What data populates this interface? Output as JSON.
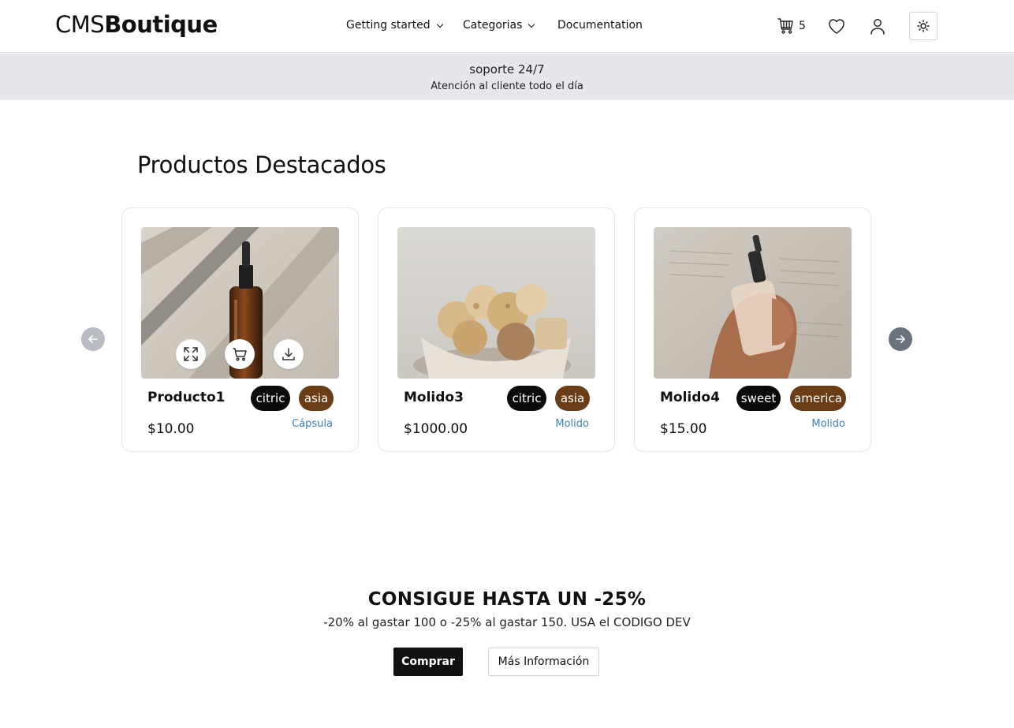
{
  "header": {
    "logo_light": "CMS",
    "logo_bold": "Boutique",
    "nav": [
      {
        "label": "Getting started",
        "has_dropdown": true
      },
      {
        "label": "Categorias",
        "has_dropdown": true
      },
      {
        "label": "Documentation",
        "has_dropdown": false
      }
    ],
    "cart_count": "5",
    "icons": [
      "cart-icon",
      "heart-icon",
      "user-icon",
      "sun-icon"
    ]
  },
  "banner": {
    "title": "soporte 24/7",
    "subtitle": "Atención al cliente todo el día"
  },
  "featured": {
    "title": "Productos Destacados",
    "products": [
      {
        "name": "Producto1",
        "price": "$10.00",
        "category": "Cápsula",
        "tags": [
          "citric",
          "asia"
        ]
      },
      {
        "name": "Molido3",
        "price": "$1000.00",
        "category": "Molido",
        "tags": [
          "citric",
          "asia"
        ]
      },
      {
        "name": "Molido4",
        "price": "$15.00",
        "category": "Molido",
        "tags": [
          "sweet",
          "america"
        ]
      }
    ]
  },
  "promo": {
    "title": "CONSIGUE HASTA UN -25%",
    "subtitle": "-20% al gastar 100 o -25% al gastar 150. USA el CODIGO DEV",
    "buy_label": "Comprar",
    "info_label": "Más Información"
  },
  "colors": {
    "banner_bg": "#e5e7eb",
    "tag_dark": "#0a0a0a",
    "tag_brown": "#6b3d16",
    "category_link": "#3b82c4",
    "button_dark": "#111111"
  }
}
